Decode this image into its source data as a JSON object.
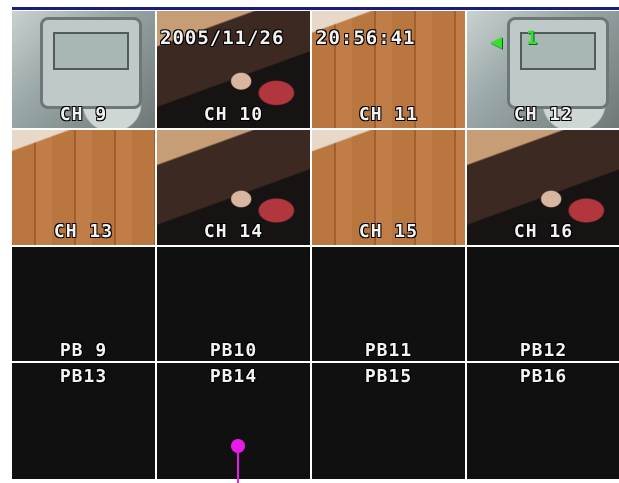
{
  "overlay": {
    "date": "2005/11/26",
    "time": "20:56:41",
    "indicator_number": "1",
    "indicator_icon": "green-left-arrow-icon",
    "indicator_color": "#35e02a"
  },
  "channels": [
    {
      "label": "CH 9"
    },
    {
      "label": "CH 10"
    },
    {
      "label": "CH 11"
    },
    {
      "label": "CH 12"
    },
    {
      "label": "CH 13"
    },
    {
      "label": "CH 14"
    },
    {
      "label": "CH 15"
    },
    {
      "label": "CH 16"
    }
  ],
  "playback": [
    {
      "label": "PB 9"
    },
    {
      "label": "PB10"
    },
    {
      "label": "PB11"
    },
    {
      "label": "PB12"
    },
    {
      "label": "PB13"
    },
    {
      "label": "PB14"
    },
    {
      "label": "PB15"
    },
    {
      "label": "PB16"
    }
  ],
  "colors": {
    "header_bar": "#1b1d7a",
    "pointer": "#e61ce6",
    "playback_bg": "#101010"
  }
}
